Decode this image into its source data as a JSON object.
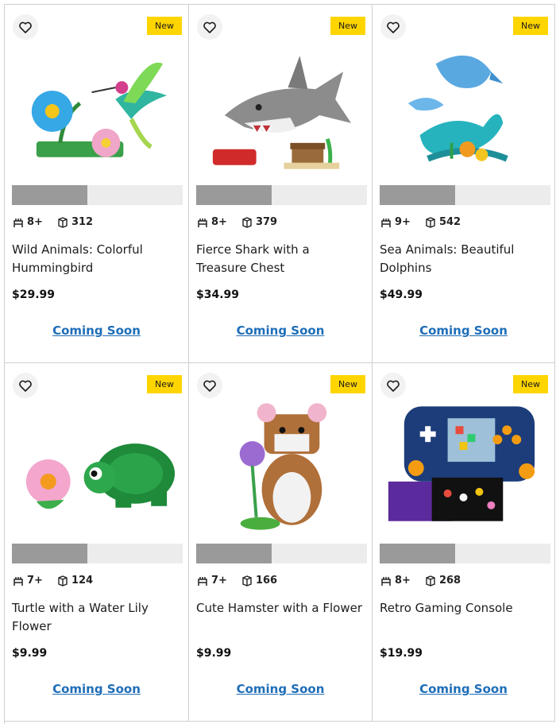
{
  "products": [
    {
      "name": "Wild Animals: Colorful Hummingbird",
      "badge": "New",
      "age": "8+",
      "pieces": "312",
      "price": "$29.99",
      "cta": "Coming Soon",
      "image": "hummingbird",
      "rating_fraction": 0.44
    },
    {
      "name": "Fierce Shark with a Treasure Chest",
      "badge": "New",
      "age": "8+",
      "pieces": "379",
      "price": "$34.99",
      "cta": "Coming Soon",
      "image": "shark",
      "rating_fraction": 0.44
    },
    {
      "name": "Sea Animals: Beautiful Dolphins",
      "badge": "New",
      "age": "9+",
      "pieces": "542",
      "price": "$49.99",
      "cta": "Coming Soon",
      "image": "dolphins",
      "rating_fraction": 0.44
    },
    {
      "name": "Turtle with a Water Lily Flower",
      "badge": "New",
      "age": "7+",
      "pieces": "124",
      "price": "$9.99",
      "cta": "Coming Soon",
      "image": "turtle",
      "rating_fraction": 0.44
    },
    {
      "name": "Cute Hamster with a Flower",
      "badge": "New",
      "age": "7+",
      "pieces": "166",
      "price": "$9.99",
      "cta": "Coming Soon",
      "image": "hamster",
      "rating_fraction": 0.44
    },
    {
      "name": "Retro Gaming Console",
      "badge": "New",
      "age": "8+",
      "pieces": "268",
      "price": "$19.99",
      "cta": "Coming Soon",
      "image": "gaming-console",
      "rating_fraction": 0.44
    }
  ],
  "colors": {
    "badge": "#ffd500",
    "link": "#1f6eb8",
    "bar_fill": "#9a9a9a",
    "bar_track": "#ececec"
  },
  "icons": {
    "wishlist": "heart-icon",
    "age": "age-icon",
    "pieces": "brick-icon"
  }
}
